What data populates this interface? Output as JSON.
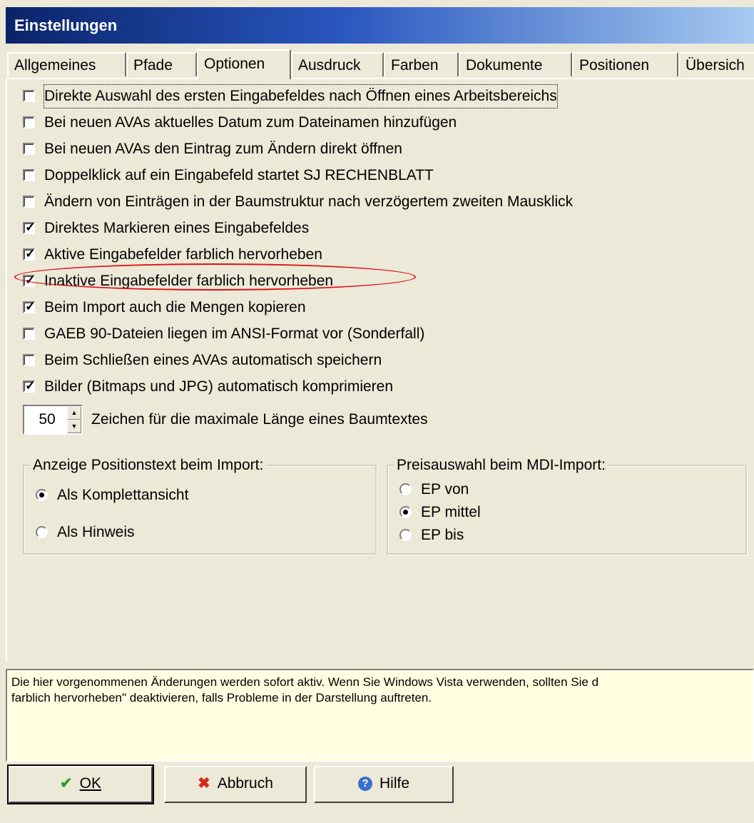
{
  "window": {
    "title": "Einstellungen"
  },
  "tabs": [
    {
      "label": "Allgemeines"
    },
    {
      "label": "Pfade"
    },
    {
      "label": "Optionen",
      "active": true
    },
    {
      "label": "Ausdruck"
    },
    {
      "label": "Farben"
    },
    {
      "label": "Dokumente"
    },
    {
      "label": "Positionen"
    },
    {
      "label": "Übersich"
    }
  ],
  "options": [
    {
      "label": "Direkte Auswahl des ersten Eingabefeldes nach Öffnen eines Arbeitsbereichs",
      "checked": false,
      "focused": true
    },
    {
      "label": "Bei neuen AVAs aktuelles Datum zum Dateinamen hinzufügen",
      "checked": false
    },
    {
      "label": "Bei neuen AVAs den Eintrag zum Ändern direkt öffnen",
      "checked": false
    },
    {
      "label": "Doppelklick auf ein Eingabefeld startet SJ RECHENBLATT",
      "checked": false
    },
    {
      "label": "Ändern von Einträgen in der Baumstruktur nach verzögertem zweiten Mausklick",
      "checked": false
    },
    {
      "label": "Direktes Markieren eines Eingabefeldes",
      "checked": true
    },
    {
      "label": "Aktive Eingabefelder farblich hervorheben",
      "checked": true
    },
    {
      "label": "Inaktive Eingabefelder farblich hervorheben",
      "checked": true,
      "highlighted": true
    },
    {
      "label": "Beim Import auch die Mengen kopieren",
      "checked": true
    },
    {
      "label": "GAEB 90-Dateien liegen im ANSI-Format vor (Sonderfall)",
      "checked": false
    },
    {
      "label": "Beim Schließen eines AVAs automatisch speichern",
      "checked": false
    },
    {
      "label": "Bilder (Bitmaps und JPG) automatisch komprimieren",
      "checked": true
    }
  ],
  "spinner": {
    "value": "50",
    "label": "Zeichen für die maximale Länge eines Baumtextes"
  },
  "group_position_text": {
    "title": "Anzeige Positionstext beim Import:",
    "options": [
      {
        "label": "Als Komplettansicht",
        "selected": true
      },
      {
        "label": "Als Hinweis",
        "selected": false
      }
    ]
  },
  "group_price": {
    "title": "Preisauswahl beim MDI-Import:",
    "options": [
      {
        "label": "EP von",
        "selected": false
      },
      {
        "label": "EP mittel",
        "selected": true
      },
      {
        "label": "EP bis",
        "selected": false
      }
    ]
  },
  "info_text": {
    "line1": "Die hier vorgenommenen Änderungen werden sofort aktiv. Wenn Sie Windows Vista verwenden, sollten Sie d",
    "line2": "farblich hervorheben\" deaktivieren, falls Probleme in der Darstellung auftreten."
  },
  "buttons": {
    "ok": "OK",
    "cancel": "Abbruch",
    "help": "Hilfe"
  },
  "colors": {
    "highlight_ellipse": "#e0101a",
    "ok_check": "#2e9a2e",
    "cancel_x": "#d42a1a",
    "help_icon": "#3a6fd0"
  }
}
